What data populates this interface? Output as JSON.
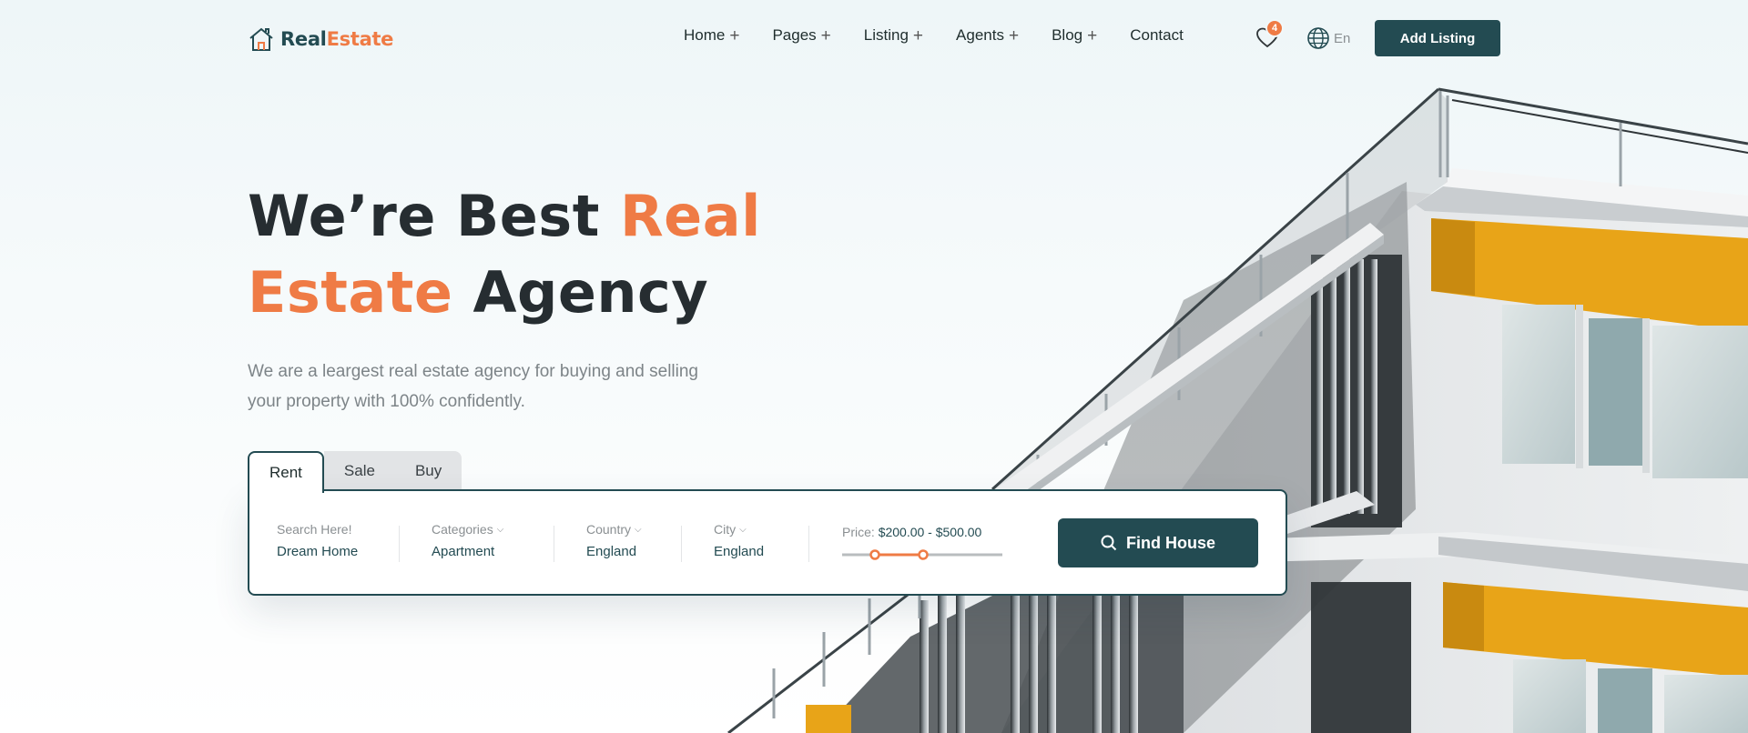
{
  "brand": {
    "name_part1": "Real",
    "name_part2": "Estate"
  },
  "nav": {
    "items": [
      {
        "label": "Home",
        "has_submenu": true
      },
      {
        "label": "Pages",
        "has_submenu": true
      },
      {
        "label": "Listing",
        "has_submenu": true
      },
      {
        "label": "Agents",
        "has_submenu": true
      },
      {
        "label": "Blog",
        "has_submenu": true
      },
      {
        "label": "Contact",
        "has_submenu": false
      }
    ],
    "wishlist_count": "4",
    "language": "En",
    "add_listing_label": "Add Listing"
  },
  "hero": {
    "title_part1": "We’re Best ",
    "title_accent": "Real Estate",
    "title_part2": " Agency",
    "subtitle": "We are a leargest real estate agency for buying and selling your property with 100% confidently."
  },
  "search": {
    "tabs": [
      "Rent",
      "Sale",
      "Buy"
    ],
    "active_tab": "Rent",
    "keyword": {
      "label": "Search Here!",
      "value": "Dream Home"
    },
    "category": {
      "label": "Categories",
      "value": "Apartment"
    },
    "country": {
      "label": "Country",
      "value": "England"
    },
    "city": {
      "label": "City",
      "value": "England"
    },
    "price": {
      "label": "Price:",
      "range_text": "$200.00 - $500.00",
      "min": 200,
      "max": 500
    },
    "button_label": "Find House"
  },
  "colors": {
    "brand_dark": "#234b52",
    "accent": "#ef7b45",
    "building_yellow": "#e8a418"
  },
  "icons": [
    "house-logo-icon",
    "plus-icon",
    "heart-icon",
    "globe-icon",
    "chevron-down-icon",
    "search-icon"
  ]
}
